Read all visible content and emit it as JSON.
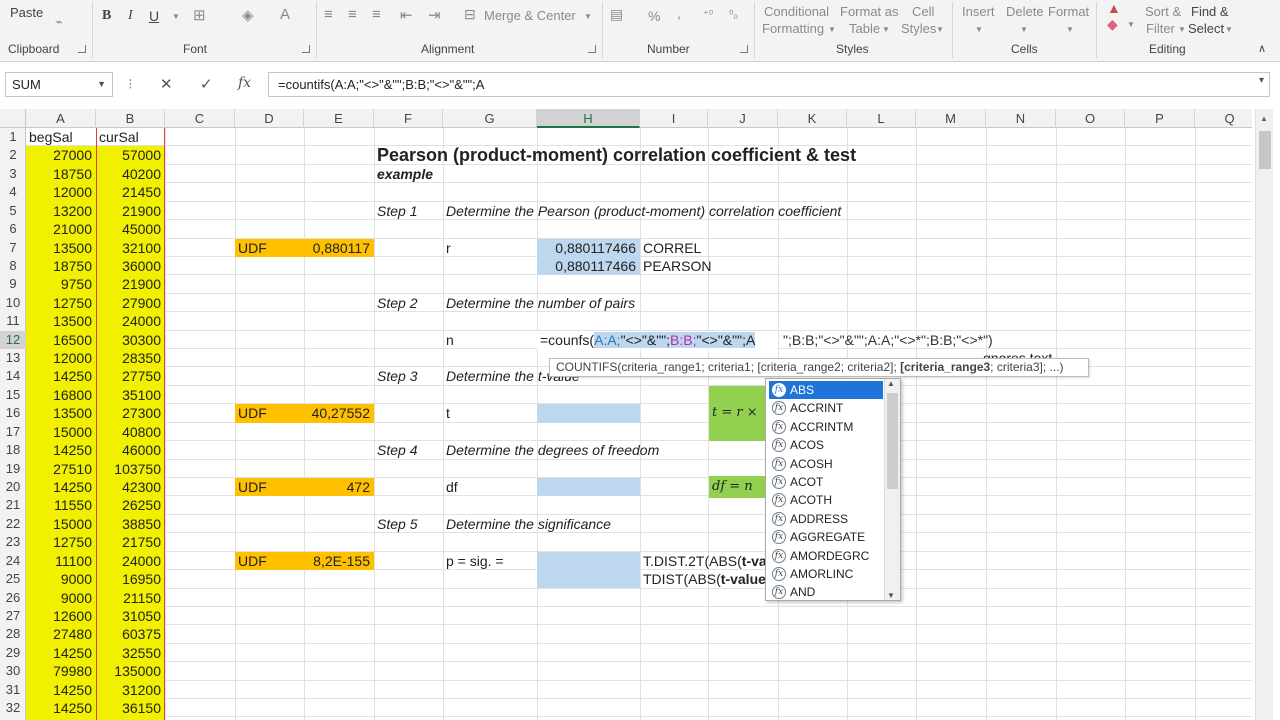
{
  "ribbon": {
    "paste": "Paste",
    "clipboard": "Clipboard",
    "font": "Font",
    "alignment": "Alignment",
    "merge_center": "Merge & Center",
    "number": "Number",
    "percent": "%",
    "comma": ",",
    "conditional_formatting_1": "Conditional",
    "conditional_formatting_2": "Formatting",
    "format_as_table_1": "Format as",
    "format_as_table_2": "Table",
    "cell_styles_1": "Cell",
    "cell_styles_2": "Styles",
    "styles": "Styles",
    "insert": "Insert",
    "delete": "Delete",
    "format": "Format",
    "cells": "Cells",
    "sort_filter_1": "Sort &",
    "sort_filter_2": "Filter",
    "find_select_1": "Find &",
    "find_select_2": "Select",
    "editing": "Editing",
    "bold": "B",
    "italic": "I",
    "underline": "U",
    "font_color": "A"
  },
  "formula_bar": {
    "name_box": "SUM",
    "formula": "=countifs(A:A;\"<>\"&\"\";B:B;\"<>\"&\"\";A",
    "cancel": "✕",
    "enter": "✓",
    "fx": "fx"
  },
  "columns": [
    "A",
    "B",
    "C",
    "D",
    "E",
    "F",
    "G",
    "H",
    "I",
    "J",
    "K",
    "L",
    "M",
    "N",
    "O",
    "P",
    "Q"
  ],
  "rows": [
    "1",
    "2",
    "3",
    "4",
    "5",
    "6",
    "7",
    "8",
    "9",
    "10",
    "11",
    "12",
    "13",
    "14",
    "15",
    "16",
    "17",
    "18",
    "19",
    "20",
    "21",
    "22",
    "23",
    "24",
    "25",
    "26",
    "27",
    "28",
    "29",
    "30",
    "31",
    "32"
  ],
  "col_a_header": "begSal",
  "col_b_header": "curSal",
  "col_a": [
    "27000",
    "18750",
    "12000",
    "13200",
    "21000",
    "13500",
    "18750",
    "9750",
    "12750",
    "13500",
    "16500",
    "12000",
    "14250",
    "16800",
    "13500",
    "15000",
    "14250",
    "27510",
    "14250",
    "11550",
    "15000",
    "12750",
    "11100",
    "9000",
    "9000",
    "12600",
    "27480",
    "14250",
    "79980",
    "14250",
    "14250"
  ],
  "col_b": [
    "57000",
    "40200",
    "21450",
    "21900",
    "45000",
    "32100",
    "36000",
    "21900",
    "27900",
    "24000",
    "30300",
    "28350",
    "27750",
    "35100",
    "27300",
    "40800",
    "46000",
    "103750",
    "42300",
    "26250",
    "38850",
    "21750",
    "24000",
    "16950",
    "21150",
    "31050",
    "60375",
    "32550",
    "135000",
    "31200",
    "36150"
  ],
  "sheet": {
    "title": "Pearson (product-moment) correlation coefficient & test",
    "example": "example",
    "step1": "Step 1",
    "step1_desc": "Determine the Pearson (product-moment) correlation coefficient",
    "udf": "UDF",
    "udf_r": "0,880117",
    "r_label": "r",
    "correl_val": "0,880117466",
    "correl": "CORREL",
    "pearson_val": "0,880117466",
    "pearson": "PEARSON",
    "step2": "Step 2",
    "step2_desc": "Determine the number of pairs",
    "n_label": "n",
    "editing_formula_a": "=coun",
    "editing_formula_b": "fs(",
    "editing_formula_c": "A:A;",
    "editing_formula_d": "\"<>\"&\"\";",
    "editing_formula_e": "B:B;",
    "editing_formula_f": "\"<>\"&\"\";A",
    "overflow_formula": "\";B:B;\"<>\"&\"\";A:A;\"<>*\";B:B;\"<>*\")",
    "ignores_text": "gnores text",
    "step3": "Step 3",
    "step3_desc": "Determine the t-value",
    "udf_t": "40,27552",
    "t_label": "t",
    "t_formula": "t = r ×",
    "step4": "Step 4",
    "step4_desc": "Determine the degrees of freedom",
    "udf_df": "472",
    "df_label": "df",
    "df_formula": "df = n",
    "step5": "Step 5",
    "step5_desc": "Determine the significance",
    "udf_p": "8,2E-155",
    "p_label": "p = sig. =",
    "tdist2t_a": "T.DIST.2T(ABS(",
    "tdist2t_b": "t-va",
    "tdist_a": "TDIST(ABS(",
    "tdist_b": "t-value"
  },
  "autocomplete": {
    "tooltip_a": "COUNTIFS(criteria_range1; criteria1; [criteria_range2; criteria2]; ",
    "tooltip_b": "[criteria_range3",
    "tooltip_c": "; criteria3]; ...)",
    "items": [
      "ABS",
      "ACCRINT",
      "ACCRINTM",
      "ACOS",
      "ACOSH",
      "ACOT",
      "ACOTH",
      "ADDRESS",
      "AGGREGATE",
      "AMORDEGRC",
      "AMORLINC",
      "AND"
    ]
  },
  "colors": {
    "yellow": "#f0f000",
    "orange": "#ffc000",
    "blue": "#bdd7ee",
    "green": "#92d050",
    "accent": "#217346"
  }
}
